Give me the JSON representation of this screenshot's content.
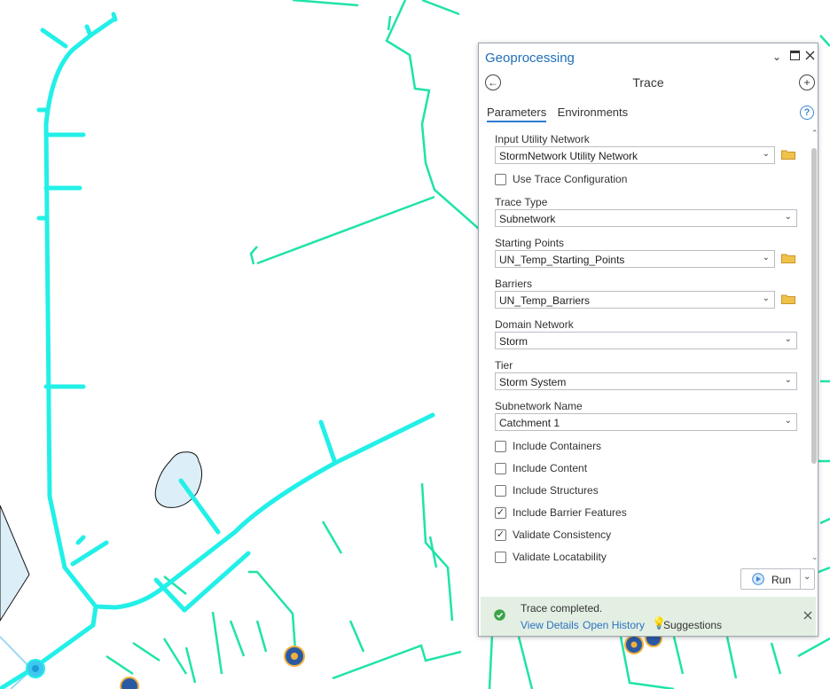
{
  "panel": {
    "title": "Geoprocessing",
    "tool_name": "Trace",
    "tabs": [
      "Parameters",
      "Environments"
    ],
    "help_symbol": "?"
  },
  "params": {
    "input_network_label": "Input Utility Network",
    "input_network_value": "StormNetwork Utility Network",
    "use_trace_config": "Use Trace Configuration",
    "trace_type_label": "Trace Type",
    "trace_type_value": "Subnetwork",
    "starting_points_label": "Starting Points",
    "starting_points_value": "UN_Temp_Starting_Points",
    "barriers_label": "Barriers",
    "barriers_value": "UN_Temp_Barriers",
    "domain_label": "Domain Network",
    "domain_value": "Storm",
    "tier_label": "Tier",
    "tier_value": "Storm System",
    "subnetwork_label": "Subnetwork Name",
    "subnetwork_value": "Catchment 1",
    "checkboxes": [
      {
        "label": "Include Containers",
        "checked": false
      },
      {
        "label": "Include Content",
        "checked": false
      },
      {
        "label": "Include Structures",
        "checked": false
      },
      {
        "label": "Include Barrier Features",
        "checked": true
      },
      {
        "label": "Validate Consistency",
        "checked": true
      },
      {
        "label": "Validate Locatability",
        "checked": false
      }
    ]
  },
  "run_label": "Run",
  "status": {
    "message": "Trace completed.",
    "view_details": "View Details",
    "open_history": "Open History",
    "suggestions": "Suggestions"
  },
  "colors": {
    "highlight": "#22f0e8",
    "network": "#1fe3a8",
    "panel_title": "#1d6fb8",
    "status_bg": "#e3efe3"
  },
  "icons": [
    "back-arrow-icon",
    "add-icon",
    "help-icon",
    "folder-icon",
    "chevron-down-icon",
    "play-icon",
    "success-icon",
    "lightbulb-icon",
    "close-icon",
    "pin-icon",
    "maximize-icon"
  ]
}
